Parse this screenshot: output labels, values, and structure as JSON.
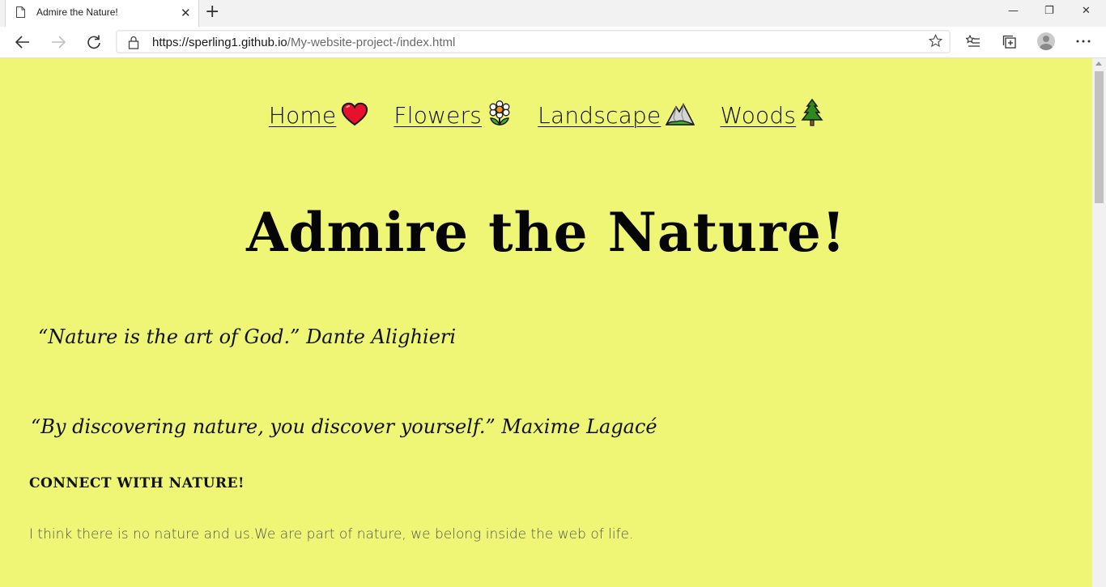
{
  "browser": {
    "tab_title": "Admire the Nature!",
    "new_tab": "+",
    "tab_close": "✕",
    "url_host": "https://sperling1.github.io",
    "url_path": "/My-website-project-/index.html",
    "window_controls": {
      "minimize": "—",
      "restore": "❐",
      "close": "✕"
    },
    "toolbar_icons": [
      "back-icon",
      "forward-icon",
      "refresh-icon",
      "lock-icon",
      "favorite-star-icon",
      "favorites-list-icon",
      "collections-icon",
      "profile-avatar-icon",
      "more-menu-icon"
    ]
  },
  "nav": {
    "items": [
      {
        "label": "Home",
        "icon": "heart-icon"
      },
      {
        "label": "Flowers",
        "icon": "flower-icon"
      },
      {
        "label": "Landscape",
        "icon": "mountain-icon"
      },
      {
        "label": "Woods",
        "icon": "tree-icon"
      }
    ]
  },
  "page": {
    "title": "Admire the Nature!",
    "quote1": "“Nature is the art of God.” Dante Alighieri",
    "quote2": "“By discovering nature, you discover yourself.” Maxime Lagacé",
    "subheading": "CONNECT WITH NATURE!",
    "paragraph": "I think there is no nature and us.We are part of nature, we belong inside the web of life."
  },
  "colors": {
    "page_background": "#eff575",
    "text": "#111111",
    "paragraph_text": "#555555"
  }
}
